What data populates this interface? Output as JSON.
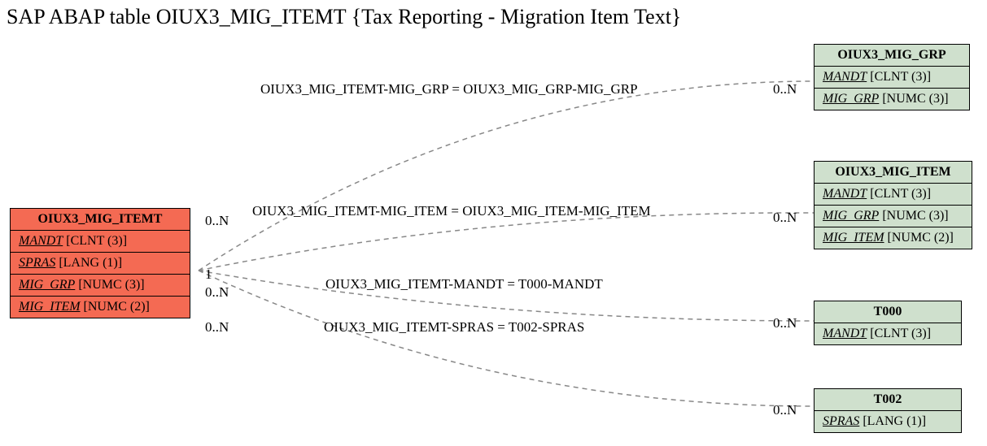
{
  "title": "SAP ABAP table OIUX3_MIG_ITEMT {Tax Reporting - Migration Item Text}",
  "left_table": {
    "name": "OIUX3_MIG_ITEMT",
    "fields": [
      {
        "key": "MANDT",
        "type": "[CLNT (3)]"
      },
      {
        "key": "SPRAS",
        "type": "[LANG (1)]"
      },
      {
        "key": "MIG_GRP",
        "type": "[NUMC (3)]"
      },
      {
        "key": "MIG_ITEM",
        "type": "[NUMC (2)]"
      }
    ]
  },
  "right_tables": [
    {
      "name": "OIUX3_MIG_GRP",
      "fields": [
        {
          "key": "MANDT",
          "type": "[CLNT (3)]"
        },
        {
          "key": "MIG_GRP",
          "type": "[NUMC (3)]"
        }
      ]
    },
    {
      "name": "OIUX3_MIG_ITEM",
      "fields": [
        {
          "key": "MANDT",
          "type": "[CLNT (3)]"
        },
        {
          "key": "MIG_GRP",
          "type": "[NUMC (3)]"
        },
        {
          "key": "MIG_ITEM",
          "type": "[NUMC (2)]"
        }
      ]
    },
    {
      "name": "T000",
      "fields": [
        {
          "key": "MANDT",
          "type": "[CLNT (3)]"
        }
      ]
    },
    {
      "name": "T002",
      "fields": [
        {
          "key": "SPRAS",
          "type": "[LANG (1)]"
        }
      ]
    }
  ],
  "relations": [
    {
      "text": "OIUX3_MIG_ITEMT-MIG_GRP = OIUX3_MIG_GRP-MIG_GRP",
      "left_card": "0..N",
      "right_card": "0..N"
    },
    {
      "text": "OIUX3_MIG_ITEMT-MIG_ITEM = OIUX3_MIG_ITEM-MIG_ITEM",
      "left_card": "1",
      "right_card": "0..N"
    },
    {
      "text": "OIUX3_MIG_ITEMT-MANDT = T000-MANDT",
      "left_card": "0..N",
      "right_card": "0..N"
    },
    {
      "text": "OIUX3_MIG_ITEMT-SPRAS = T002-SPRAS",
      "left_card": "0..N",
      "right_card": "0..N"
    }
  ]
}
